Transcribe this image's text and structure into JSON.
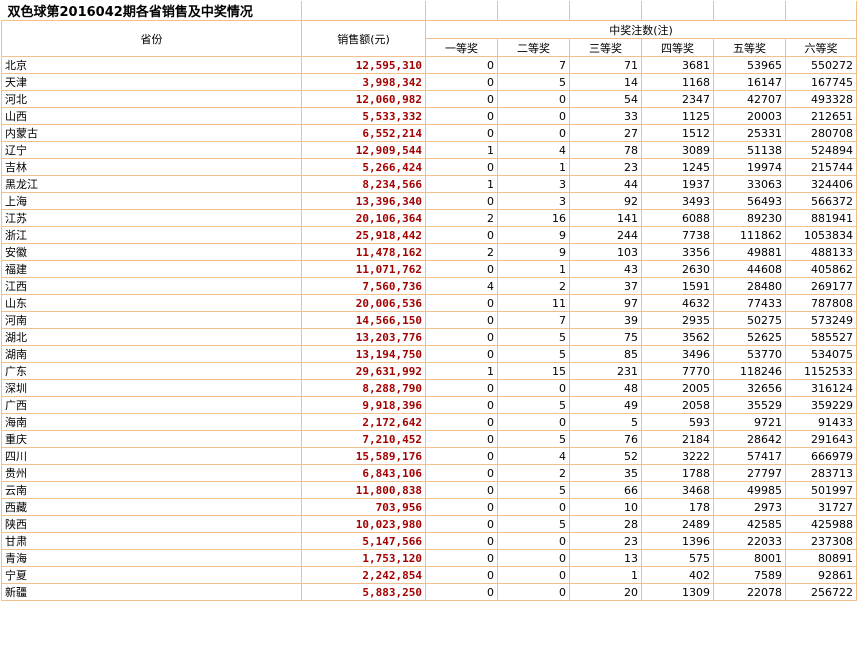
{
  "title": "双色球第2016042期各省销售及中奖情况",
  "headers": {
    "province": "省份",
    "sales": "销售额(元)",
    "winners": "中奖注数(注)",
    "prizes": [
      "一等奖",
      "二等奖",
      "三等奖",
      "四等奖",
      "五等奖",
      "六等奖"
    ]
  },
  "rows": [
    {
      "province": "北京",
      "sales": "12,595,310",
      "p": [
        "0",
        "7",
        "71",
        "3681",
        "53965",
        "550272"
      ]
    },
    {
      "province": "天津",
      "sales": "3,998,342",
      "p": [
        "0",
        "5",
        "14",
        "1168",
        "16147",
        "167745"
      ]
    },
    {
      "province": "河北",
      "sales": "12,060,982",
      "p": [
        "0",
        "0",
        "54",
        "2347",
        "42707",
        "493328"
      ]
    },
    {
      "province": "山西",
      "sales": "5,533,332",
      "p": [
        "0",
        "0",
        "33",
        "1125",
        "20003",
        "212651"
      ]
    },
    {
      "province": "内蒙古",
      "sales": "6,552,214",
      "p": [
        "0",
        "0",
        "27",
        "1512",
        "25331",
        "280708"
      ]
    },
    {
      "province": "辽宁",
      "sales": "12,909,544",
      "p": [
        "1",
        "4",
        "78",
        "3089",
        "51138",
        "524894"
      ]
    },
    {
      "province": "吉林",
      "sales": "5,266,424",
      "p": [
        "0",
        "1",
        "23",
        "1245",
        "19974",
        "215744"
      ]
    },
    {
      "province": "黑龙江",
      "sales": "8,234,566",
      "p": [
        "1",
        "3",
        "44",
        "1937",
        "33063",
        "324406"
      ]
    },
    {
      "province": "上海",
      "sales": "13,396,340",
      "p": [
        "0",
        "3",
        "92",
        "3493",
        "56493",
        "566372"
      ]
    },
    {
      "province": "江苏",
      "sales": "20,106,364",
      "p": [
        "2",
        "16",
        "141",
        "6088",
        "89230",
        "881941"
      ]
    },
    {
      "province": "浙江",
      "sales": "25,918,442",
      "p": [
        "0",
        "9",
        "244",
        "7738",
        "111862",
        "1053834"
      ]
    },
    {
      "province": "安徽",
      "sales": "11,478,162",
      "p": [
        "2",
        "9",
        "103",
        "3356",
        "49881",
        "488133"
      ]
    },
    {
      "province": "福建",
      "sales": "11,071,762",
      "p": [
        "0",
        "1",
        "43",
        "2630",
        "44608",
        "405862"
      ]
    },
    {
      "province": "江西",
      "sales": "7,560,736",
      "p": [
        "4",
        "2",
        "37",
        "1591",
        "28480",
        "269177"
      ]
    },
    {
      "province": "山东",
      "sales": "20,006,536",
      "p": [
        "0",
        "11",
        "97",
        "4632",
        "77433",
        "787808"
      ]
    },
    {
      "province": "河南",
      "sales": "14,566,150",
      "p": [
        "0",
        "7",
        "39",
        "2935",
        "50275",
        "573249"
      ]
    },
    {
      "province": "湖北",
      "sales": "13,203,776",
      "p": [
        "0",
        "5",
        "75",
        "3562",
        "52625",
        "585527"
      ]
    },
    {
      "province": "湖南",
      "sales": "13,194,750",
      "p": [
        "0",
        "5",
        "85",
        "3496",
        "53770",
        "534075"
      ]
    },
    {
      "province": "广东",
      "sales": "29,631,992",
      "p": [
        "1",
        "15",
        "231",
        "7770",
        "118246",
        "1152533"
      ]
    },
    {
      "province": "深圳",
      "sales": "8,288,790",
      "p": [
        "0",
        "0",
        "48",
        "2005",
        "32656",
        "316124"
      ]
    },
    {
      "province": "广西",
      "sales": "9,918,396",
      "p": [
        "0",
        "5",
        "49",
        "2058",
        "35529",
        "359229"
      ]
    },
    {
      "province": "海南",
      "sales": "2,172,642",
      "p": [
        "0",
        "0",
        "5",
        "593",
        "9721",
        "91433"
      ]
    },
    {
      "province": "重庆",
      "sales": "7,210,452",
      "p": [
        "0",
        "5",
        "76",
        "2184",
        "28642",
        "291643"
      ]
    },
    {
      "province": "四川",
      "sales": "15,589,176",
      "p": [
        "0",
        "4",
        "52",
        "3222",
        "57417",
        "666979"
      ]
    },
    {
      "province": "贵州",
      "sales": "6,843,106",
      "p": [
        "0",
        "2",
        "35",
        "1788",
        "27797",
        "283713"
      ]
    },
    {
      "province": "云南",
      "sales": "11,800,838",
      "p": [
        "0",
        "5",
        "66",
        "3468",
        "49985",
        "501997"
      ]
    },
    {
      "province": "西藏",
      "sales": "703,956",
      "p": [
        "0",
        "0",
        "10",
        "178",
        "2973",
        "31727"
      ]
    },
    {
      "province": "陕西",
      "sales": "10,023,980",
      "p": [
        "0",
        "5",
        "28",
        "2489",
        "42585",
        "425988"
      ]
    },
    {
      "province": "甘肃",
      "sales": "5,147,566",
      "p": [
        "0",
        "0",
        "23",
        "1396",
        "22033",
        "237308"
      ]
    },
    {
      "province": "青海",
      "sales": "1,753,120",
      "p": [
        "0",
        "0",
        "13",
        "575",
        "8001",
        "80891"
      ]
    },
    {
      "province": "宁夏",
      "sales": "2,242,854",
      "p": [
        "0",
        "0",
        "1",
        "402",
        "7589",
        "92861"
      ]
    },
    {
      "province": "新疆",
      "sales": "5,883,250",
      "p": [
        "0",
        "0",
        "20",
        "1309",
        "22078",
        "256722"
      ]
    }
  ]
}
